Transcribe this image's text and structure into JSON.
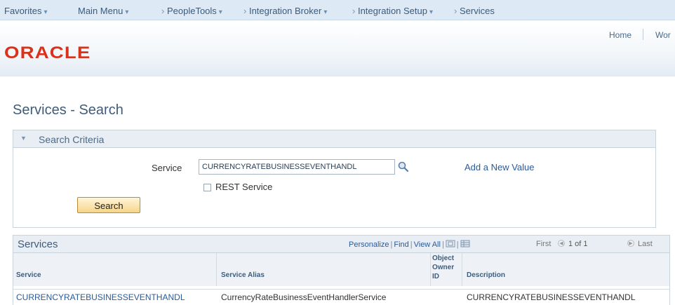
{
  "nav": {
    "favorites": "Favorites",
    "main_menu": "Main Menu",
    "peopletools": "PeopleTools",
    "integration_broker": "Integration Broker",
    "integration_setup": "Integration Setup",
    "services": "Services",
    "dropdown_glyph": "▾",
    "crumb_sep": "›"
  },
  "header": {
    "logo": "ORACLE",
    "home": "Home",
    "worklist": "Wor"
  },
  "page": {
    "title": "Services - Search"
  },
  "criteria": {
    "title": "Search Criteria",
    "service_label": "Service",
    "service_value": "CURRENCYRATEBUSINESSEVENTHANDL",
    "add_new": "Add a New Value",
    "rest_label": "REST Service",
    "rest_checked": false,
    "search_button": "Search"
  },
  "grid": {
    "title": "Services",
    "personalize": "Personalize",
    "find": "Find",
    "view_all": "View All",
    "first": "First",
    "count": "1 of 1",
    "last": "Last",
    "columns": [
      "Service",
      "Service Alias",
      "Object Owner ID",
      "Description"
    ],
    "col_object_owner": [
      "Object",
      "Owner",
      "ID"
    ],
    "rows": [
      {
        "service": "CURRENCYRATEBUSINESSEVENTHANDL",
        "alias": "CurrencyRateBusinessEventHandlerService",
        "owner": "",
        "description": "CURRENCYRATEBUSINESSEVENTHANDL"
      }
    ]
  },
  "colors": {
    "nav_bg": "#dde9f5",
    "oracle_red": "#d9321c",
    "link_blue": "#2a5a99",
    "header_blue": "#3f5c7a"
  },
  "icons": {
    "lookup": "magnifier-icon",
    "expand": "triangle-down-icon",
    "zoom": "zoom-icon",
    "download": "grid-download-icon",
    "prev": "arrow-left-icon",
    "next": "arrow-right-icon"
  }
}
